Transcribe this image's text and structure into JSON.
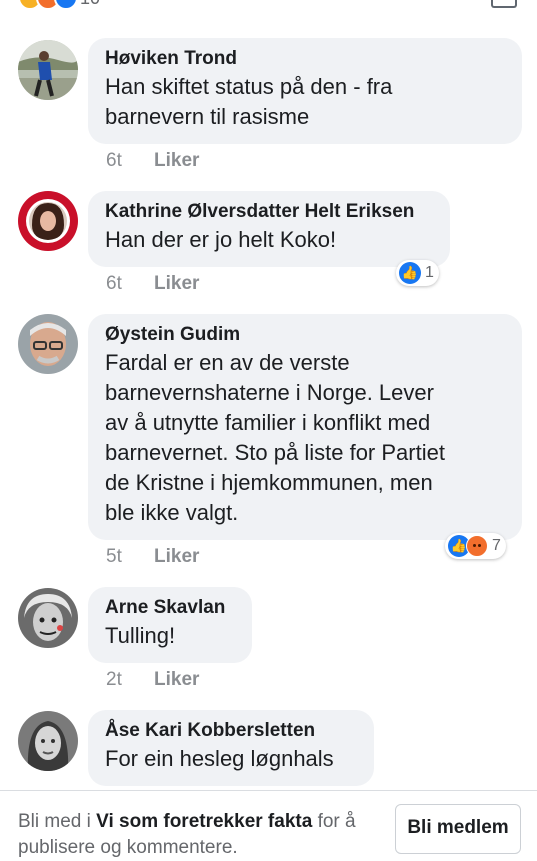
{
  "top_reactions": {
    "count": "10",
    "colors": [
      "#f7b125",
      "#f26e2c",
      "#1877f2"
    ]
  },
  "comments": [
    {
      "author": "Høviken Trond",
      "text_lines": [
        "Han skiftet status på den - fra",
        "barnevern til rasisme"
      ],
      "time": "6t",
      "like_label": "Liker"
    },
    {
      "author": "Kathrine Ølversdatter Helt Eriksen",
      "text_lines": [
        "Han der er jo helt Koko!"
      ],
      "time": "6t",
      "like_label": "Liker",
      "reactions": {
        "icons": [
          "like-icon"
        ],
        "count": "1"
      }
    },
    {
      "author": "Øystein Gudim",
      "text_lines": [
        "Fardal er en av de verste",
        "barnevernshaterne i Norge. Lever",
        "av å utnytte familier i konflikt med",
        "barnevernet. Sto på liste for Partiet",
        "de Kristne i hjemkommunen, men",
        "ble ikke valgt."
      ],
      "time": "5t",
      "like_label": "Liker",
      "reactions": {
        "icons": [
          "like-icon",
          "angry-icon"
        ],
        "count": "7"
      }
    },
    {
      "author": "Arne Skavlan",
      "text_lines": [
        "Tulling!"
      ],
      "time": "2t",
      "like_label": "Liker"
    },
    {
      "author": "Åse Kari Kobbersletten",
      "text_lines": [
        "For ein hesleg løgnhals"
      ]
    }
  ],
  "footer": {
    "prefix": "Bli med i ",
    "group_name": "Vi som foretrekker fakta",
    "suffix": " for å publisere og kommentere.",
    "join_button": "Bli medlem"
  }
}
